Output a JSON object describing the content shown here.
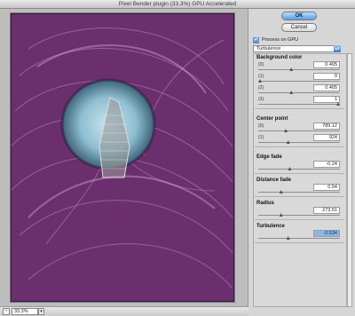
{
  "window": {
    "title": "Pixel Bender plugin (33.3%) GPU Accelerated"
  },
  "buttons": {
    "ok": "OK",
    "cancel": "Cancel"
  },
  "gpu": {
    "label": "Process on GPU",
    "checked": true
  },
  "filter": {
    "selected": "Turbulence"
  },
  "zoom": {
    "value": "33.3%",
    "minus": "-"
  },
  "groups": [
    {
      "title": "Background color",
      "rows": [
        {
          "label": "(0)",
          "value": "0.405",
          "level": 0.4
        },
        {
          "label": "(1)",
          "value": "0",
          "level": 0.0
        },
        {
          "label": "(2)",
          "value": "0.405",
          "level": 0.4
        },
        {
          "label": "(3)",
          "value": "1",
          "level": 1.0
        }
      ]
    },
    {
      "title": "Center point",
      "rows": [
        {
          "label": "(0)",
          "value": "789.12",
          "level": 0.33
        },
        {
          "label": "(1)",
          "value": "924",
          "level": 0.36
        }
      ]
    },
    {
      "title": "Edge fade",
      "rows": [
        {
          "label": "",
          "value": "-0.24",
          "level": 0.38
        }
      ]
    },
    {
      "title": "Distance fade",
      "rows": [
        {
          "label": "",
          "value": "0.54",
          "level": 0.27
        }
      ]
    },
    {
      "title": "Radius",
      "rows": [
        {
          "label": "",
          "value": "273.51",
          "level": 0.27
        }
      ]
    },
    {
      "title": "Turbulence",
      "rows": [
        {
          "label": "",
          "value": "-0.534",
          "level": 0.36,
          "selected": true
        }
      ]
    }
  ]
}
